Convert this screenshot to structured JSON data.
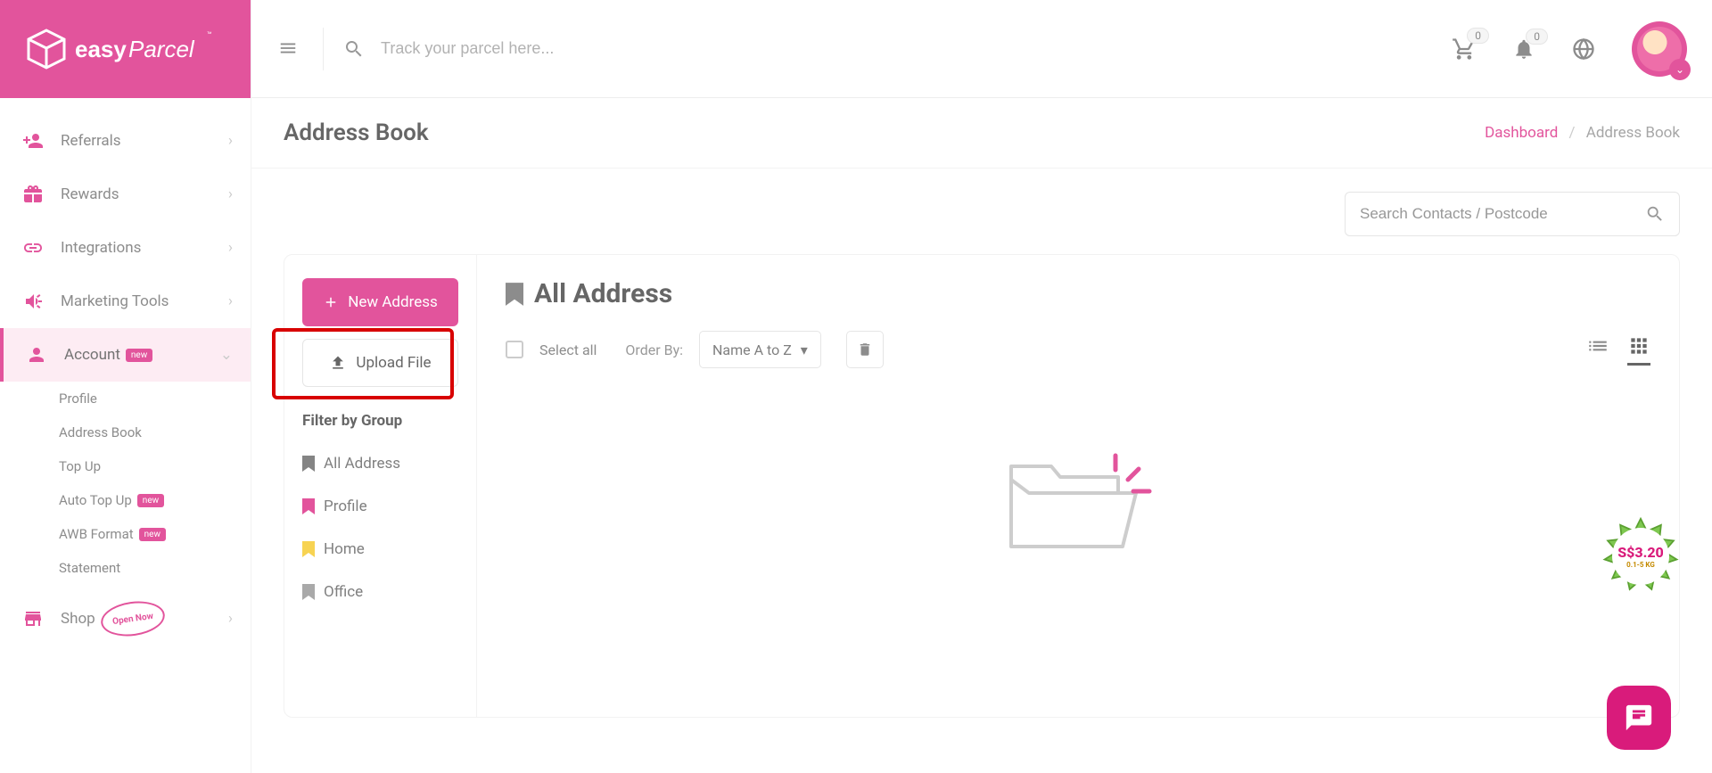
{
  "brand": {
    "name": "easyParcel"
  },
  "header": {
    "search_placeholder": "Track your parcel here...",
    "cart_count": "0",
    "notif_count": "0"
  },
  "sidebar": {
    "items": [
      {
        "label": "Referrals"
      },
      {
        "label": "Rewards"
      },
      {
        "label": "Integrations"
      },
      {
        "label": "Marketing Tools"
      },
      {
        "label": "Account",
        "badge": "new"
      },
      {
        "label": "Shop",
        "extra": "Open Now"
      }
    ],
    "account_sub": [
      {
        "label": "Profile"
      },
      {
        "label": "Address Book"
      },
      {
        "label": "Top Up"
      },
      {
        "label": "Auto Top Up",
        "badge": "new"
      },
      {
        "label": "AWB Format",
        "badge": "new"
      },
      {
        "label": "Statement"
      }
    ]
  },
  "page": {
    "title": "Address Book",
    "breadcrumbs": {
      "dashboard": "Dashboard",
      "sep": "/",
      "current": "Address Book"
    }
  },
  "search": {
    "placeholder": "Search Contacts / Postcode"
  },
  "actions": {
    "new_address": "New Address",
    "upload_file": "Upload File"
  },
  "filter": {
    "title": "Filter by Group",
    "groups": [
      {
        "label": "All Address",
        "color": "#5b5b5b"
      },
      {
        "label": "Profile",
        "color": "#d91b7b"
      },
      {
        "label": "Home",
        "color": "#f5c518"
      },
      {
        "label": "Office",
        "color": "#8d8d8d"
      }
    ]
  },
  "list": {
    "heading": "All Address",
    "select_all": "Select all",
    "order_by": "Order By:",
    "sort": "Name A to Z"
  },
  "promo": {
    "price": "S$3.20",
    "weight": "0.1-5 KG"
  }
}
